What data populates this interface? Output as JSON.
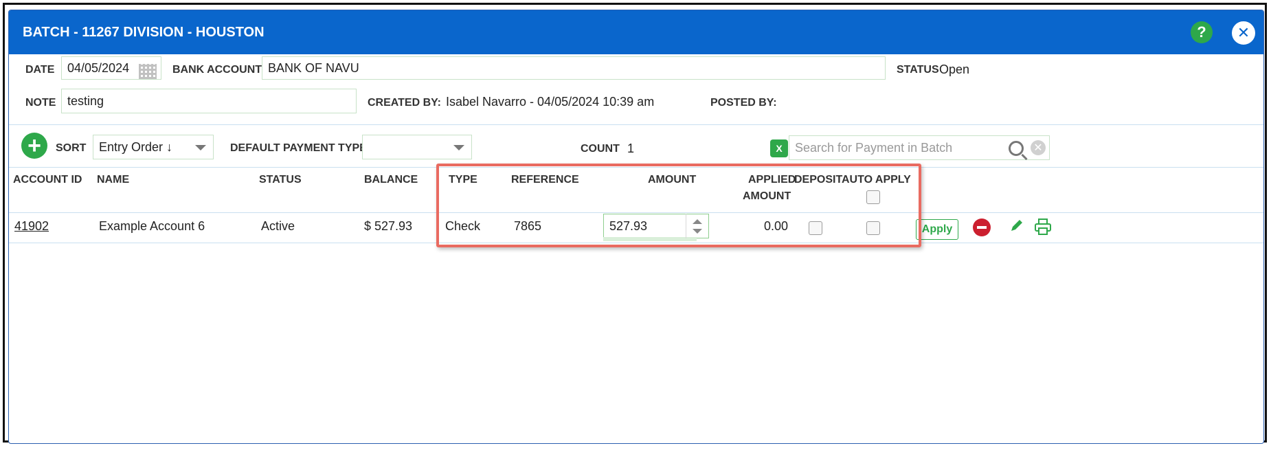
{
  "title": "BATCH - 11267 DIVISION - HOUSTON",
  "header": {
    "date_label": "DATE",
    "date_value": "04/05/2024",
    "bank_account_label": "BANK ACCOUNT",
    "bank_account_value": "BANK OF NAVU",
    "status_label": "STATUS",
    "status_value": "Open",
    "note_label": "NOTE",
    "note_value": "testing",
    "created_by_label": "CREATED BY:",
    "created_by_value": "Isabel Navarro - 04/05/2024 10:39 am",
    "posted_by_label": "POSTED BY:",
    "posted_by_value": ""
  },
  "toolbar": {
    "sort_label": "SORT",
    "sort_value": "Entry Order ↓",
    "default_payment_type_label": "DEFAULT PAYMENT TYPE",
    "default_payment_type_value": "",
    "count_label": "COUNT",
    "count_value": "1",
    "search_placeholder": "Search for Payment in Batch"
  },
  "table": {
    "columns": {
      "account_id": "ACCOUNT ID",
      "name": "NAME",
      "status": "STATUS",
      "balance": "BALANCE",
      "type": "TYPE",
      "reference": "REFERENCE",
      "amount": "AMOUNT",
      "applied_amount_1": "APPLIED",
      "applied_amount_2": "AMOUNT",
      "deposit": "DEPOSIT",
      "auto_apply": "AUTO APPLY"
    },
    "rows": [
      {
        "account_id": "41902",
        "name": "Example Account 6",
        "status": "Active",
        "balance": "$ 527.93",
        "type": "Check",
        "reference": "7865",
        "amount": "527.93",
        "applied_amount": "0.00",
        "apply_label": "Apply"
      }
    ]
  },
  "icons": {
    "help": "question-mark",
    "close": "x",
    "add": "plus",
    "excel": "excel-export"
  },
  "colors": {
    "titlebar": "#0a66cc",
    "accent_green": "#2ea84a",
    "remove_red": "#cc1f2f",
    "highlight": "#e96b61"
  }
}
